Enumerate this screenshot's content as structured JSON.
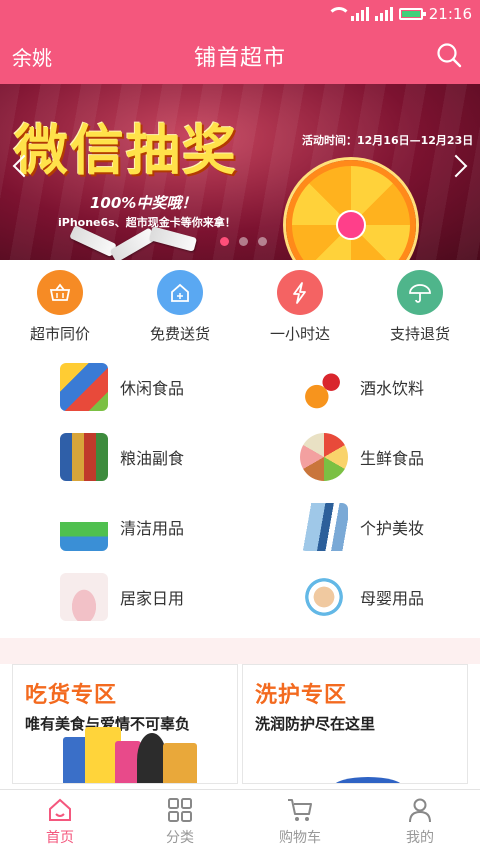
{
  "status_bar": {
    "time": "21:16"
  },
  "header": {
    "city": "余姚",
    "title": "铺首超市"
  },
  "banner": {
    "headline": "微信抽奖",
    "period": "活动时间：12月16日—12月23日",
    "prize_line": "100%中奖哦！",
    "prize_detail": "iPhone6s、超市现金卡等你来拿！"
  },
  "features": [
    {
      "label": "超市同价",
      "color": "#f68b25",
      "icon": "basket-icon"
    },
    {
      "label": "免费送货",
      "color": "#5aa8f2",
      "icon": "home-icon"
    },
    {
      "label": "一小时达",
      "color": "#f46363",
      "icon": "lightning-icon"
    },
    {
      "label": "支持退货",
      "color": "#4fb58b",
      "icon": "umbrella-icon"
    }
  ],
  "categories": [
    {
      "name": "休闲食品"
    },
    {
      "name": "酒水饮料"
    },
    {
      "name": "粮油副食"
    },
    {
      "name": "生鲜食品"
    },
    {
      "name": "清洁用品"
    },
    {
      "name": "个护美妆"
    },
    {
      "name": "居家日用"
    },
    {
      "name": "母婴用品"
    }
  ],
  "promos": [
    {
      "title": "吃货专区",
      "subtitle": "唯有美食与爱情不可辜负"
    },
    {
      "title": "洗护专区",
      "subtitle": "洗润防护尽在这里"
    }
  ],
  "tabs": [
    {
      "label": "首页",
      "active": true
    },
    {
      "label": "分类",
      "active": false
    },
    {
      "label": "购物车",
      "active": false
    },
    {
      "label": "我的",
      "active": false
    }
  ],
  "colors": {
    "brand": "#f4577d",
    "promo_title": "#f36a1f"
  }
}
